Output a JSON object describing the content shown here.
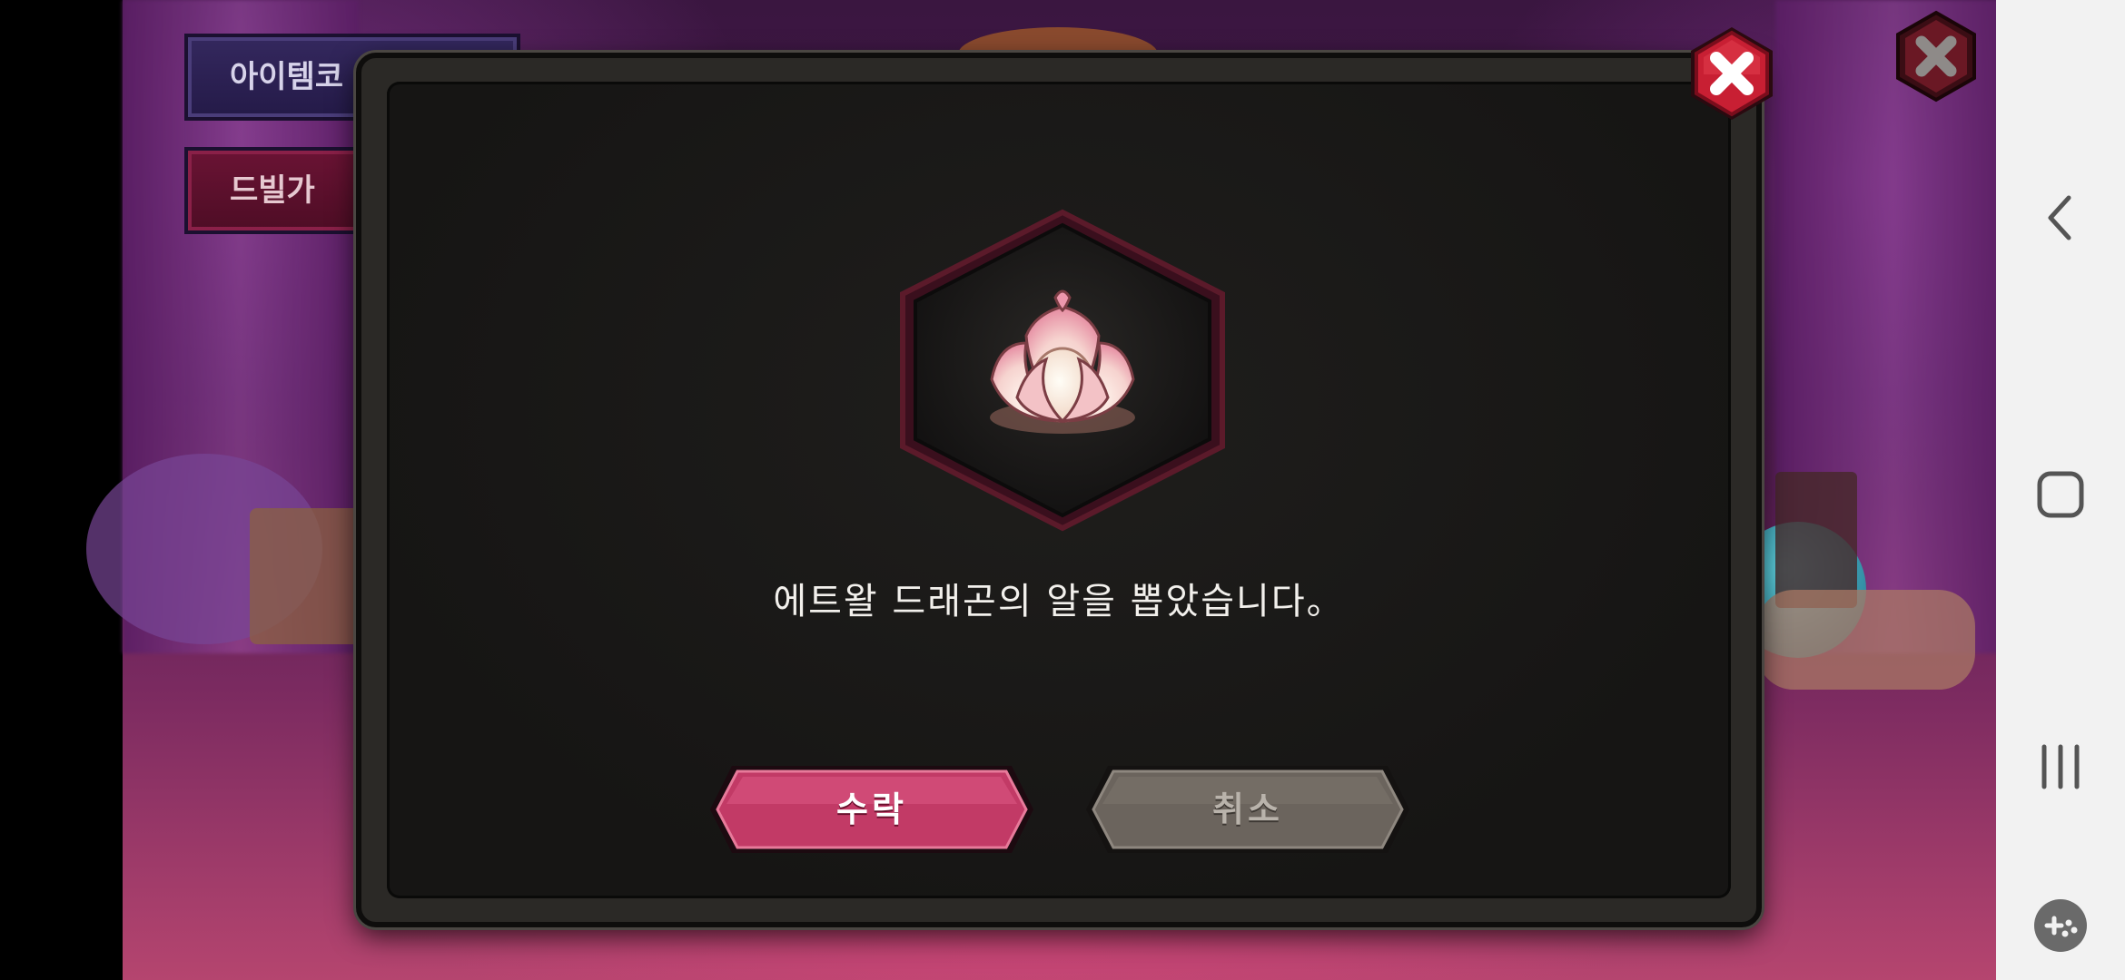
{
  "background_menu": {
    "item_code_label": "아이템코",
    "devil_label": "드빌가"
  },
  "dialog": {
    "message": "에트왈 드래곤의 알을 뽑았습니다。",
    "item_icon": "lotus-dragon-egg-icon",
    "accept_label": "수락",
    "cancel_label": "취소"
  },
  "nav_bar": {
    "back_icon": "back-chevron-icon",
    "home_icon": "home-icon",
    "recents_icon": "recents-icon",
    "game_tools_icon": "game-tools-icon"
  },
  "colors": {
    "accept": "#c23a66",
    "cancel": "#6b645d",
    "close_red": "#c81f33",
    "dialog_bg": "#1b1a18",
    "frame_border": "#5b1a2a"
  }
}
